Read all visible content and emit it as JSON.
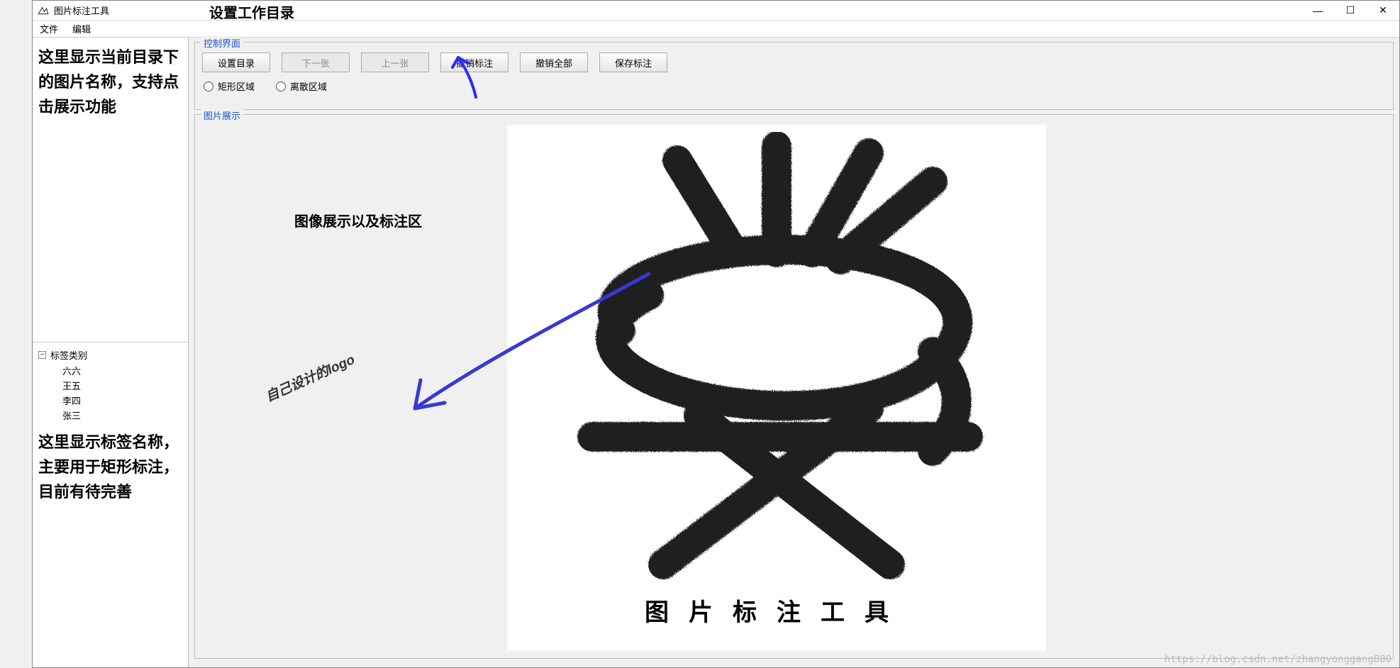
{
  "window": {
    "title": "图片标注工具",
    "controls": {
      "min": "—",
      "max": "☐",
      "close": "✕"
    }
  },
  "menu": {
    "file": "文件",
    "edit": "编辑"
  },
  "sidebar": {
    "top_desc": "这里显示当前目录下的图片名称，支持点击展示功能",
    "tree_label": "标签类别",
    "tree_toggle": "−",
    "items": [
      {
        "label": "六六"
      },
      {
        "label": "王五"
      },
      {
        "label": "李四"
      },
      {
        "label": "张三"
      }
    ],
    "bottom_desc": "这里显示标签名称，主要用于矩形标注，目前有待完善"
  },
  "control_panel": {
    "group_label": "控制界面",
    "buttons": {
      "set_dir": "设置目录",
      "next": "下一张",
      "prev": "上一张",
      "undo": "撤销标注",
      "undo_all": "撤销全部",
      "save": "保存标注"
    },
    "radios": {
      "rect": "矩形区域",
      "scatter": "离散区域"
    }
  },
  "display_panel": {
    "group_label": "图片展示",
    "logo_caption": "图片标注工具"
  },
  "annotations": {
    "top": "设置工作目录",
    "mid": "图像展示以及标注区",
    "logo": "自己设计的logo"
  },
  "watermark": "https://blog.csdn.net/zhangyonggang880"
}
